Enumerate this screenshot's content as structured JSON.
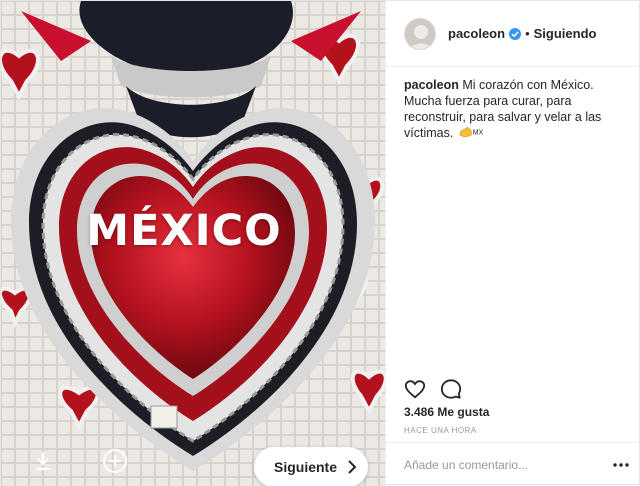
{
  "media": {
    "photo_text": "MÉXICO",
    "next_label": "Siguiente"
  },
  "header": {
    "username": "pacoleon",
    "separator": "•",
    "follow_status": "Siguiendo"
  },
  "caption": {
    "username": "pacoleon",
    "text": "Mi corazón con México. Mucha fuerza para curar, para reconstruir, para salvar y velar a las víctimas.",
    "flag_text": "MX"
  },
  "stats": {
    "likes": "3.486 Me gusta",
    "time_ago": "HACE UNA HORA"
  },
  "comment": {
    "placeholder": "Añade un comentario..."
  },
  "colors": {
    "verified_blue": "#3897f0",
    "heart_red": "#c8102e"
  }
}
